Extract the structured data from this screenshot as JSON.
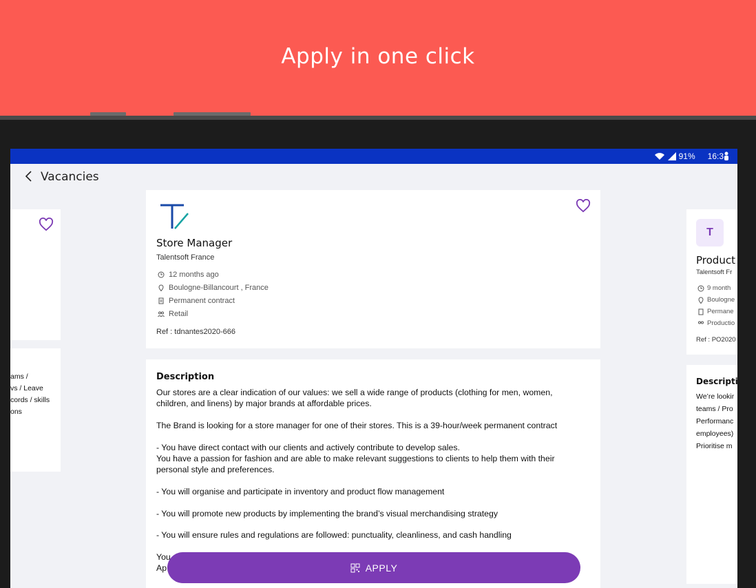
{
  "banner": {
    "title": "Apply in one click"
  },
  "statusbar": {
    "battery": "91%",
    "time": "16:3"
  },
  "appbar": {
    "title": "Vacancies"
  },
  "main_job": {
    "title": "Store Manager",
    "company": "Talentsoft France",
    "posted": "12 months ago",
    "location": "Boulogne-Billancourt , France",
    "contract": "Permanent contract",
    "category": "Retail",
    "ref": "Ref : tdnantes2020-666"
  },
  "description": {
    "heading": "Description",
    "paragraphs": [
      "Our stores are a clear indication of our values: we sell a wide range of products (clothing for men, women, children, and linens) by major brands at affordable prices.",
      "The Brand is looking for a store manager for one of their stores. This is a 39-hour/week permanent contract",
      "- You have direct contact with our clients and actively contribute to develop sales.\nYou have a passion for fashion and are able to make relevant suggestions to clients to help them with their personal style and preferences.",
      "- You will organise and participate in inventory and product flow management",
      "- You will promote new products by implementing the brand’s visual merchandising strategy",
      "- You will ensure rules and regulations are followed: punctuality, cleanliness, and cash handling",
      "You\nAp"
    ]
  },
  "left_card": {
    "lines": [
      "ams /",
      "vs / Leave",
      "cords / skills",
      "ons"
    ]
  },
  "right_job": {
    "avatar_letter": "T",
    "title": "Product",
    "company": "Talentsoft Fr",
    "posted": "9 month",
    "location": "Boulogne",
    "contract": "Permane",
    "category": "Productio",
    "ref": "Ref : PO2020"
  },
  "right_description": {
    "heading": "Descriptio",
    "lines": [
      "We’re lookir",
      "teams / Pro",
      "Performanc",
      "employees)",
      "Prioritise m"
    ]
  },
  "apply_button": {
    "label": "APPLY"
  },
  "colors": {
    "banner": "#fc5a52",
    "statusbar": "#0a33c2",
    "accent": "#7c3bb5"
  }
}
